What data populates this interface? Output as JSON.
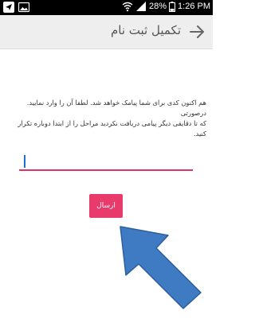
{
  "status_bar": {
    "battery_percent": "28%",
    "time": "1:26 PM",
    "icons": [
      "navigation-icon",
      "image-icon",
      "wifi-icon",
      "signal-icon",
      "battery-icon"
    ]
  },
  "header": {
    "title": "تکمیل ثبت نام",
    "back_icon": "arrow-right-icon"
  },
  "main": {
    "message_lines": [
      "هم اکنون کدی برای شما پیامک خواهد شد. لطفا آن را وارد نمایید. درصورتی",
      "که تا دقایقی دیگر پیامی دریافت نکردید مراحل را از ابتدا دوباره تکرار کنید."
    ],
    "code_input_value": "",
    "send_label": "ارسال"
  },
  "colors": {
    "accent": "#e93a6c",
    "pointer_arrow": "#3e7bc2",
    "app_bar": "#eeeeee",
    "status_bar": "#000000"
  }
}
